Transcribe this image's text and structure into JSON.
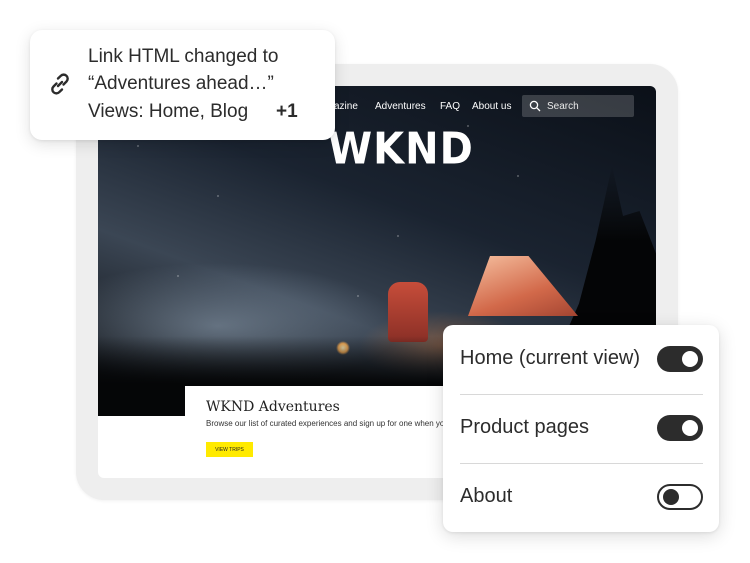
{
  "notification": {
    "line1": "Link HTML changed to",
    "line2": "“Adventures ahead…”",
    "line3": "Views: Home, Blog",
    "plus": "+1",
    "icon": "link-icon"
  },
  "website": {
    "nav": {
      "magazine": "azine",
      "adventures": "Adventures",
      "faq": "FAQ",
      "about": "About us",
      "search_placeholder": "Search"
    },
    "logo": "WKND",
    "card": {
      "title": "WKND Adventures",
      "subtitle": "Browse our list of curated experiences and sign up for one when you",
      "button": "VIEW TRIPS"
    }
  },
  "toggles": [
    {
      "label": "Home (current view)",
      "on": true
    },
    {
      "label": "Product pages",
      "on": true
    },
    {
      "label": "About",
      "on": false
    }
  ],
  "colors": {
    "accent_button": "#ffea00",
    "toggle_on": "#2c2c2c",
    "text": "#2c2c2c"
  }
}
